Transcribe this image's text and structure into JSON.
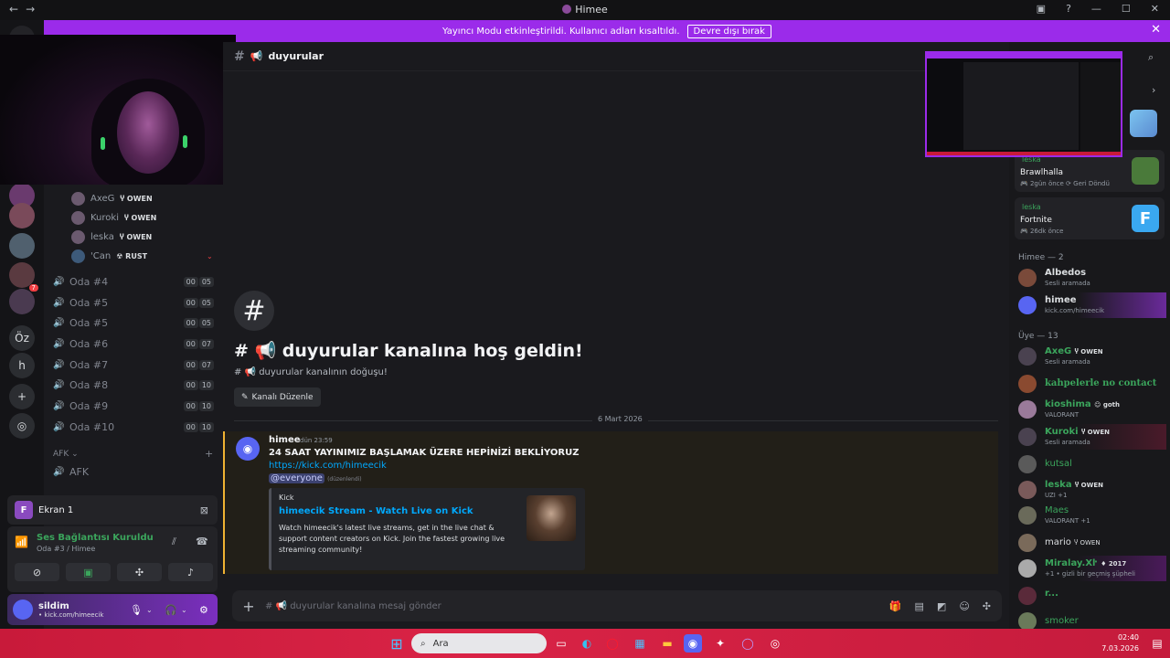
{
  "window": {
    "title": "Himee"
  },
  "banner": {
    "text": "Yayıncı Modu etkinleştirildi. Kullanıcı adları kısaltıldı.",
    "button": "Devre dışı bırak"
  },
  "guilds": {
    "labels": [
      "Öz",
      "h"
    ],
    "badge": "7"
  },
  "voice_members": [
    {
      "name": "AxeG",
      "tag": "OWEN"
    },
    {
      "name": "Kuroki",
      "tag": "OWEN"
    },
    {
      "name": "leska",
      "tag": "OWEN"
    },
    {
      "name": "'Can",
      "tag": "RUST"
    }
  ],
  "voice_channels": [
    {
      "name": "Oda #4",
      "c1": "00",
      "c2": "05"
    },
    {
      "name": "Oda #5",
      "c1": "00",
      "c2": "05"
    },
    {
      "name": "Oda #5",
      "c1": "00",
      "c2": "05"
    },
    {
      "name": "Oda #6",
      "c1": "00",
      "c2": "07"
    },
    {
      "name": "Oda #7",
      "c1": "00",
      "c2": "07"
    },
    {
      "name": "Oda #8",
      "c1": "00",
      "c2": "10"
    },
    {
      "name": "Oda #9",
      "c1": "00",
      "c2": "10"
    },
    {
      "name": "Oda #10",
      "c1": "00",
      "c2": "10"
    }
  ],
  "afk": {
    "category": "AFK",
    "channel": "AFK"
  },
  "screen_share": {
    "letter": "F",
    "label": "Ekran 1"
  },
  "voice_status": {
    "title": "Ses Bağlantısı Kuruldu",
    "sub": "Oda #3 / Himee"
  },
  "user": {
    "name": "sildim",
    "status": "kick.com/himeecik"
  },
  "channel": {
    "name": "duyurular",
    "welcome_title": "# 📢 duyurular kanalına hoş geldin!",
    "welcome_sub": "# 📢 duyurular kanalının doğuşu!",
    "edit_label": "Kanalı Düzenle",
    "date_divider": "6 Mart 2026"
  },
  "message": {
    "author": "himee",
    "time": "dün 23:59",
    "text": "24 SAAT YAYINIMIZ BAŞLAMAK ÜZERE HEPİNİZİ BEKLİYORUZ",
    "link": "https://kick.com/himeecik",
    "mention": "@everyone",
    "edited": "(düzenlendi)",
    "embed": {
      "provider": "Kick",
      "title": "himeecik Stream - Watch Live on Kick",
      "description": "Watch himeecik's latest live streams, get in the live chat & support content creators on Kick. Join the fastest growing live streaming community!"
    }
  },
  "composer": {
    "placeholder": "# 📢 duyurular kanalına mesaj gönder"
  },
  "activities": [
    {
      "user": "leska",
      "game": "Brawlhalla",
      "meta": "2gün önce",
      "extra": "Geri Döndü"
    },
    {
      "user": "leska",
      "game": "Fortnite",
      "meta": "26dk önce",
      "extra": ""
    }
  ],
  "member_groups": {
    "himee": "Himee — 2",
    "uye": "Üye — 13"
  },
  "members": [
    {
      "name": "Albedos",
      "status": "Sesli aramada",
      "tag": "",
      "color": "#f2f3f5"
    },
    {
      "name": "himee",
      "status": "kick.com/himeecik",
      "tag": "",
      "color": "#f2f3f5"
    },
    {
      "name": "AxeG",
      "status": "Sesli aramada",
      "tag": "OWEN",
      "color": "#3ba55c"
    },
    {
      "name": "kahpelerle no contact",
      "status": "",
      "tag": "",
      "color": "#3ba55c"
    },
    {
      "name": "kioshima",
      "status": "VALORANT",
      "tag": "goth",
      "color": "#3ba55c"
    },
    {
      "name": "Kuroki",
      "status": "Sesli aramada",
      "tag": "OWEN",
      "color": "#3ba55c"
    },
    {
      "name": "kutsal",
      "status": "",
      "tag": "",
      "color": "#3ba55c"
    },
    {
      "name": "leska",
      "status": "UZI +1",
      "tag": "OWEN",
      "color": "#3ba55c"
    },
    {
      "name": "Maes",
      "status": "VALORANT +1",
      "tag": "",
      "color": "#3ba55c"
    },
    {
      "name": "mario",
      "status": "",
      "tag": "OWEN",
      "color": "#f2f3f5"
    },
    {
      "name": "Miralay.Xŀ",
      "status": "+1 • gizli bir geçmiş şüpheli",
      "tag": "2017",
      "color": "#3ba55c"
    },
    {
      "name": "r...",
      "status": "",
      "tag": "",
      "color": "#3ba55c"
    },
    {
      "name": "smoker",
      "status": "",
      "tag": "",
      "color": "#3ba55c"
    }
  ],
  "taskbar": {
    "search": "Ara",
    "time": "02:40",
    "date": "7.03.2026"
  }
}
